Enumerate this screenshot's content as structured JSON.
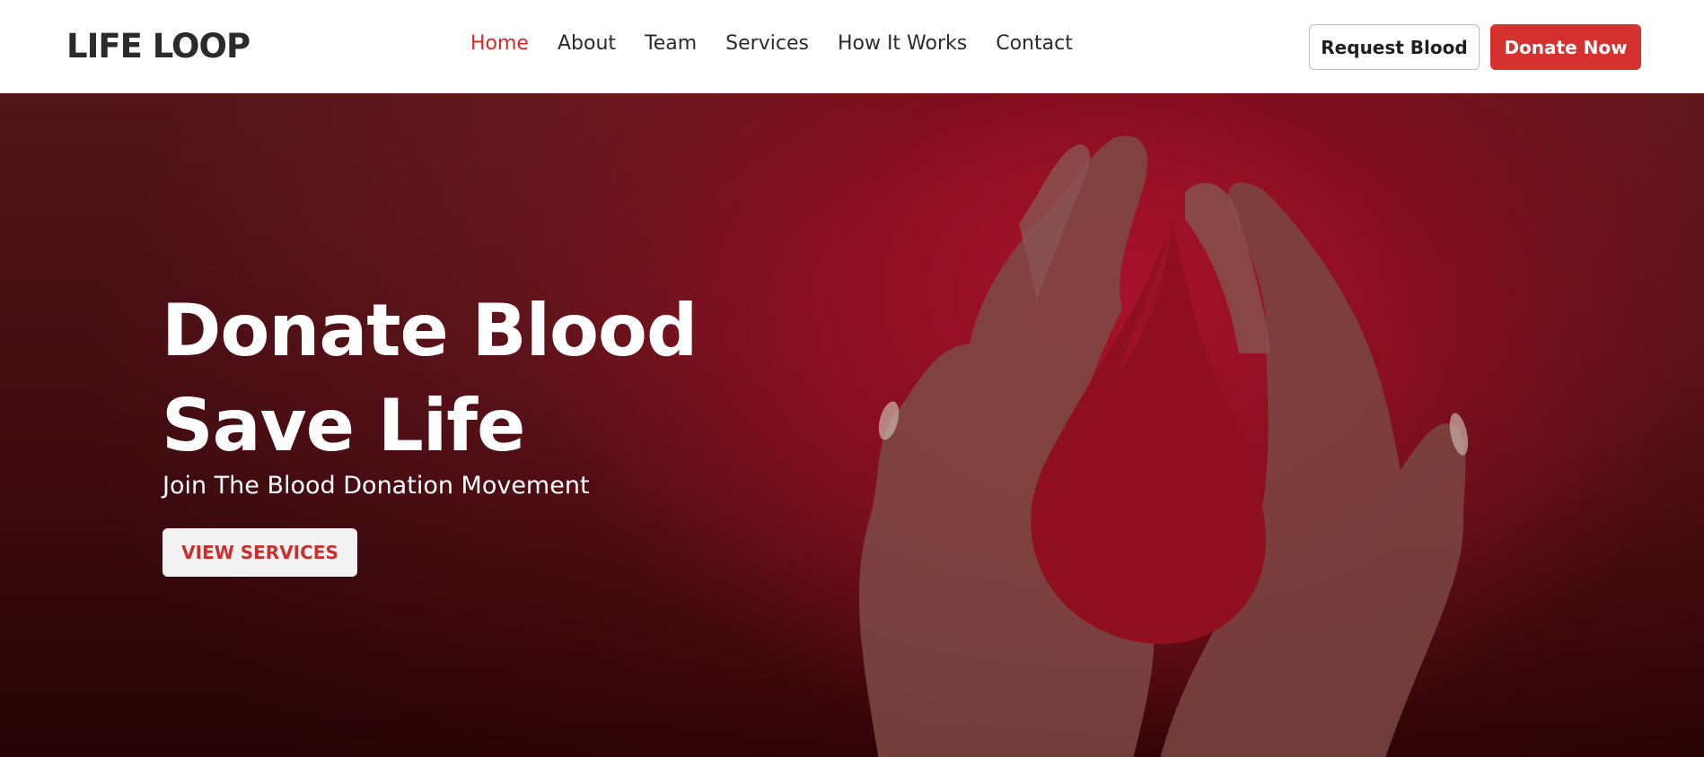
{
  "header": {
    "logo": "LIFE LOOP",
    "nav": [
      {
        "label": "Home",
        "active": true
      },
      {
        "label": "About",
        "active": false
      },
      {
        "label": "Team",
        "active": false
      },
      {
        "label": "Services",
        "active": false
      },
      {
        "label": "How It Works",
        "active": false
      },
      {
        "label": "Contact",
        "active": false
      }
    ],
    "request_button": "Request Blood",
    "donate_button": "Donate Now"
  },
  "hero": {
    "title_line1": "Donate Blood",
    "title_line2": "Save Life",
    "subtitle": "Join The Blood Donation Movement",
    "cta": "VIEW SERVICES",
    "image": "hands-holding-blood-drop-image"
  },
  "colors": {
    "accent": "#d5312f",
    "hero_background": "#7d1f25",
    "text_dark": "#2b2b2b"
  }
}
